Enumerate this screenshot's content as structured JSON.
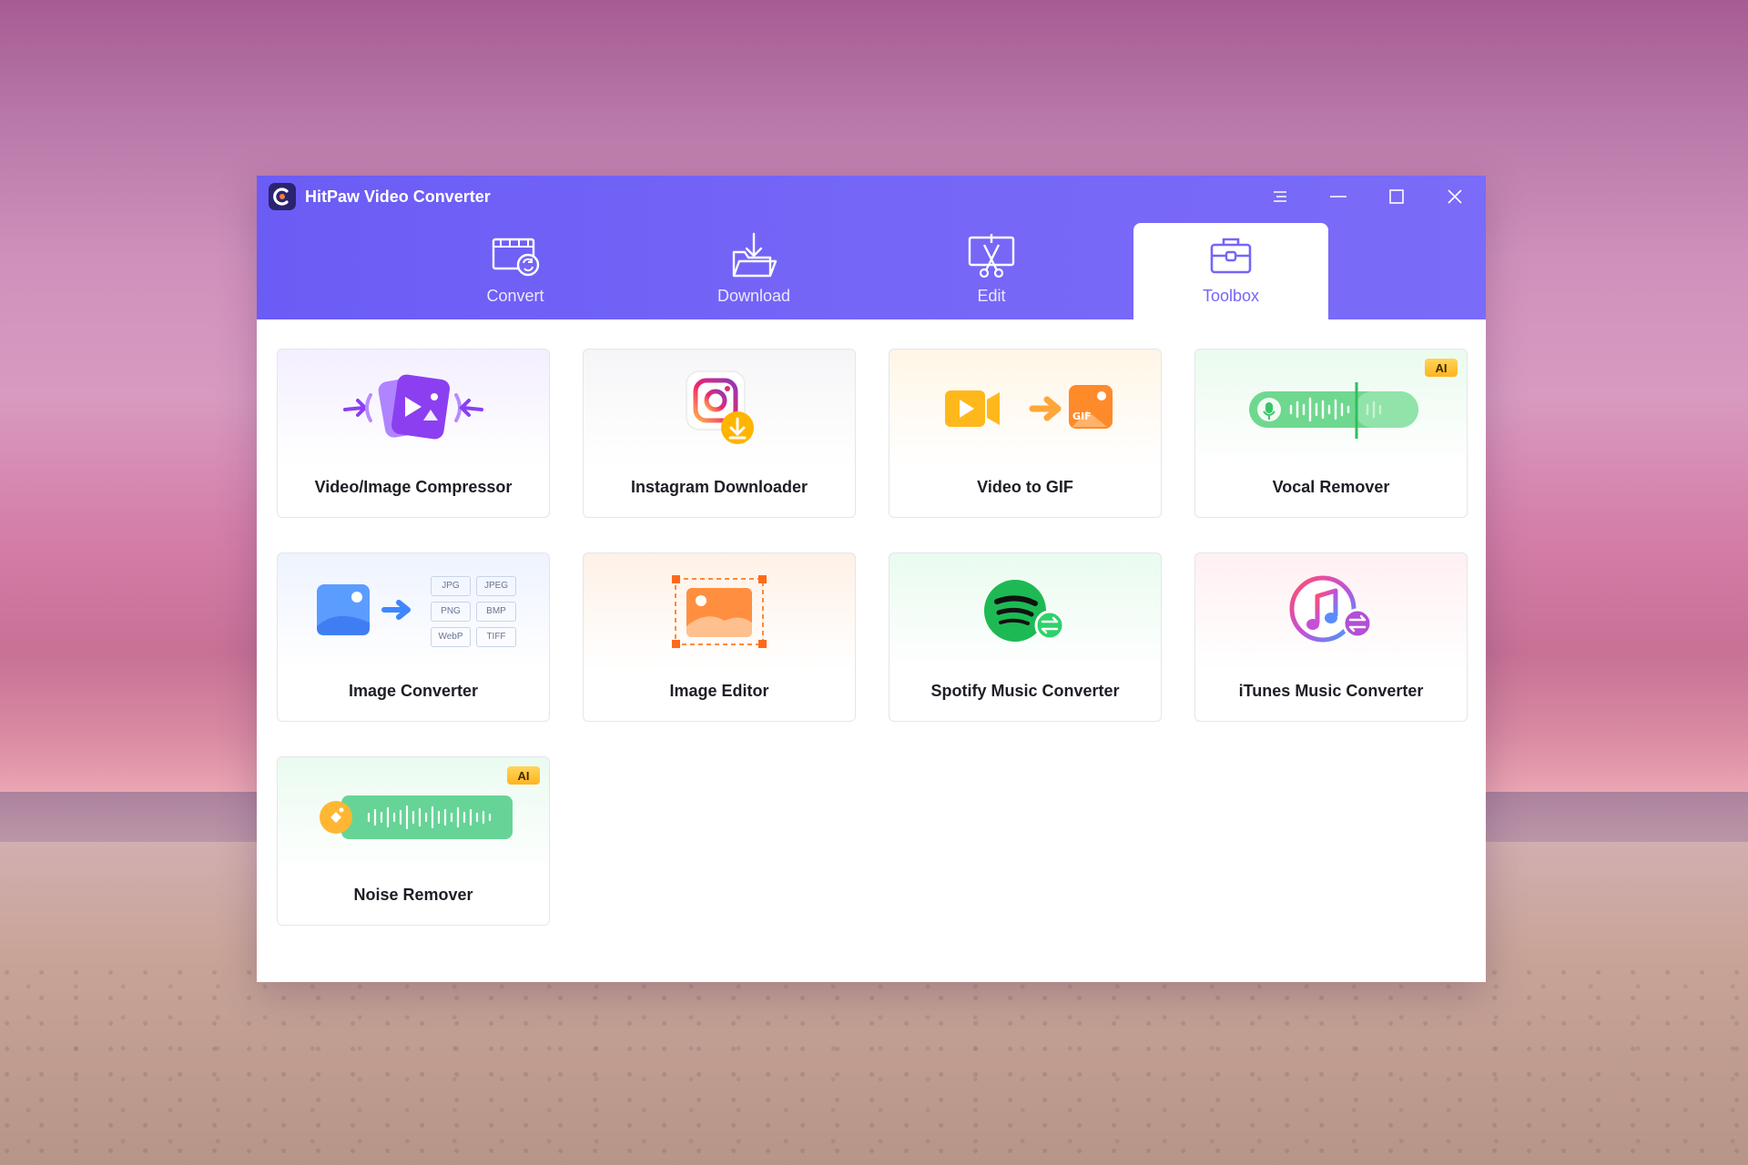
{
  "app": {
    "title": "HitPaw Video Converter"
  },
  "window_controls": [
    "menu-icon",
    "minimize-icon",
    "maximize-icon",
    "close-icon"
  ],
  "tabs": [
    {
      "label": "Convert",
      "icon": "convert-icon",
      "active": false
    },
    {
      "label": "Download",
      "icon": "download-icon",
      "active": false
    },
    {
      "label": "Edit",
      "icon": "edit-icon",
      "active": false
    },
    {
      "label": "Toolbox",
      "icon": "toolbox-icon",
      "active": true
    }
  ],
  "tools": [
    {
      "label": "Video/Image Compressor",
      "icon": "compressor-icon",
      "ai": false
    },
    {
      "label": "Instagram Downloader",
      "icon": "instagram-icon",
      "ai": false
    },
    {
      "label": "Video to GIF",
      "icon": "video-to-gif-icon",
      "ai": false
    },
    {
      "label": "Vocal Remover",
      "icon": "vocal-remover-icon",
      "ai": true,
      "badge": "AI"
    },
    {
      "label": "Image Converter",
      "icon": "image-converter-icon",
      "ai": false,
      "formats": [
        "JPG",
        "JPEG",
        "PNG",
        "BMP",
        "WebP",
        "TIFF"
      ]
    },
    {
      "label": "Image Editor",
      "icon": "image-editor-icon",
      "ai": false
    },
    {
      "label": "Spotify Music Converter",
      "icon": "spotify-icon",
      "ai": false
    },
    {
      "label": "iTunes Music Converter",
      "icon": "itunes-icon",
      "ai": false
    },
    {
      "label": "Noise Remover",
      "icon": "noise-remover-icon",
      "ai": true,
      "badge": "AI"
    }
  ],
  "colors": {
    "accent": "#7566f7",
    "ai_badge": "#ffc13a",
    "card_border": "#e5e5ec"
  }
}
